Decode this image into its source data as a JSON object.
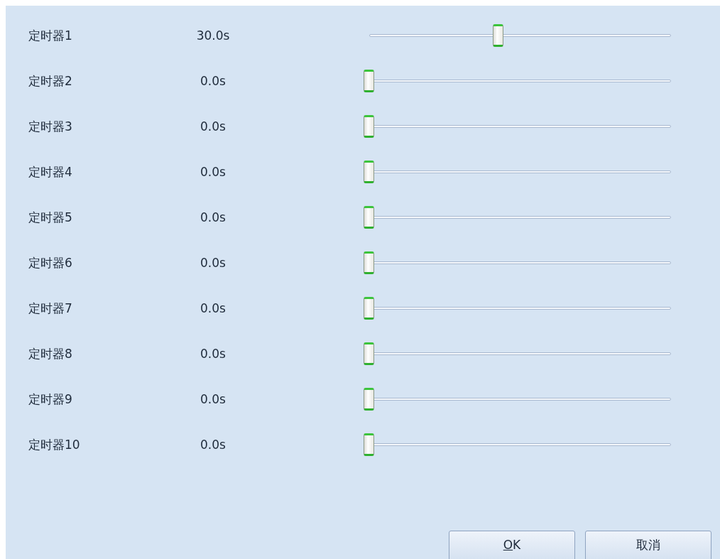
{
  "timers": [
    {
      "name": "定时器1",
      "reading": "30.0s",
      "level": 0.43
    },
    {
      "name": "定时器2",
      "reading": "0.0s",
      "level": 0
    },
    {
      "name": "定时器3",
      "reading": "0.0s",
      "level": 0
    },
    {
      "name": "定时器4",
      "reading": "0.0s",
      "level": 0
    },
    {
      "name": "定时器5",
      "reading": "0.0s",
      "level": 0
    },
    {
      "name": "定时器6",
      "reading": "0.0s",
      "level": 0
    },
    {
      "name": "定时器7",
      "reading": "0.0s",
      "level": 0
    },
    {
      "name": "定时器8",
      "reading": "0.0s",
      "level": 0
    },
    {
      "name": "定时器9",
      "reading": "0.0s",
      "level": 0
    },
    {
      "name": "定时器10",
      "reading": "0.0s",
      "level": 0
    }
  ],
  "buttons": [
    {
      "label": "OK",
      "underline_first": true
    },
    {
      "label": "取消",
      "underline_first": false
    }
  ]
}
